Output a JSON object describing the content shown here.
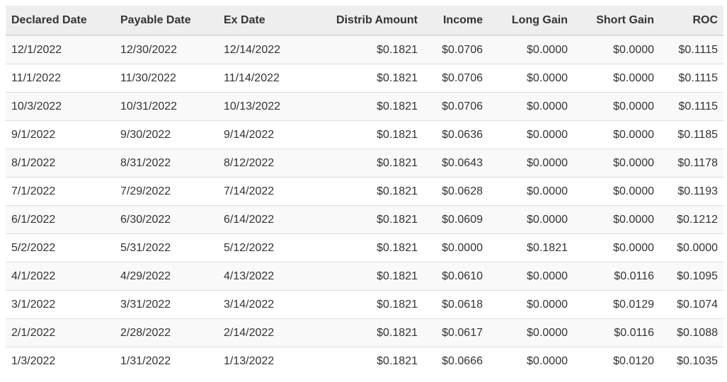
{
  "table": {
    "headers": [
      "Declared Date",
      "Payable Date",
      "Ex Date",
      "Distrib Amount",
      "Income",
      "Long Gain",
      "Short Gain",
      "ROC"
    ],
    "rows": [
      [
        "12/1/2022",
        "12/30/2022",
        "12/14/2022",
        "$0.1821",
        "$0.0706",
        "$0.0000",
        "$0.0000",
        "$0.1115"
      ],
      [
        "11/1/2022",
        "11/30/2022",
        "11/14/2022",
        "$0.1821",
        "$0.0706",
        "$0.0000",
        "$0.0000",
        "$0.1115"
      ],
      [
        "10/3/2022",
        "10/31/2022",
        "10/13/2022",
        "$0.1821",
        "$0.0706",
        "$0.0000",
        "$0.0000",
        "$0.1115"
      ],
      [
        "9/1/2022",
        "9/30/2022",
        "9/14/2022",
        "$0.1821",
        "$0.0636",
        "$0.0000",
        "$0.0000",
        "$0.1185"
      ],
      [
        "8/1/2022",
        "8/31/2022",
        "8/12/2022",
        "$0.1821",
        "$0.0643",
        "$0.0000",
        "$0.0000",
        "$0.1178"
      ],
      [
        "7/1/2022",
        "7/29/2022",
        "7/14/2022",
        "$0.1821",
        "$0.0628",
        "$0.0000",
        "$0.0000",
        "$0.1193"
      ],
      [
        "6/1/2022",
        "6/30/2022",
        "6/14/2022",
        "$0.1821",
        "$0.0609",
        "$0.0000",
        "$0.0000",
        "$0.1212"
      ],
      [
        "5/2/2022",
        "5/31/2022",
        "5/12/2022",
        "$0.1821",
        "$0.0000",
        "$0.1821",
        "$0.0000",
        "$0.0000"
      ],
      [
        "4/1/2022",
        "4/29/2022",
        "4/13/2022",
        "$0.1821",
        "$0.0610",
        "$0.0000",
        "$0.0116",
        "$0.1095"
      ],
      [
        "3/1/2022",
        "3/31/2022",
        "3/14/2022",
        "$0.1821",
        "$0.0618",
        "$0.0000",
        "$0.0129",
        "$0.1074"
      ],
      [
        "2/1/2022",
        "2/28/2022",
        "2/14/2022",
        "$0.1821",
        "$0.0617",
        "$0.0000",
        "$0.0116",
        "$0.1088"
      ],
      [
        "1/3/2022",
        "1/31/2022",
        "1/13/2022",
        "$0.1821",
        "$0.0666",
        "$0.0000",
        "$0.0120",
        "$0.1035"
      ]
    ]
  }
}
